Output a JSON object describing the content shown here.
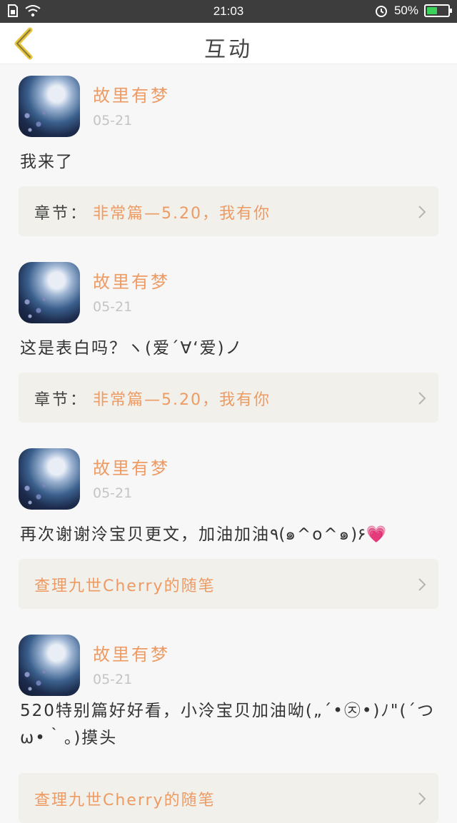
{
  "status_bar": {
    "time": "21:03",
    "battery": "50%",
    "battery_level": 0.5
  },
  "header": {
    "title": "互动"
  },
  "comments": [
    {
      "user": "故里有梦",
      "date": "05-21",
      "text": "我来了",
      "chapter_prefix": "章节：",
      "chapter_title": "非常篇—5.20，我有你"
    },
    {
      "user": "故里有梦",
      "date": "05-21",
      "text": "这是表白吗？ヽ(爱´∀‘爱)ノ",
      "chapter_prefix": "章节：",
      "chapter_title": "非常篇—5.20，我有你"
    },
    {
      "user": "故里有梦",
      "date": "05-21",
      "text": "再次谢谢泠宝贝更文，加油加油٩(๑^o^๑)۶💗",
      "chapter_prefix": "",
      "chapter_title": "查理九世Cherry的随笔"
    },
    {
      "user": "故里有梦",
      "date": "05-21",
      "text": "520特别篇好好看，小泠宝贝加油呦(„´•㉨•)ﾉ\"(´つω•｀。)摸头",
      "chapter_prefix": "",
      "chapter_title": "查理九世Cherry的随笔"
    }
  ]
}
